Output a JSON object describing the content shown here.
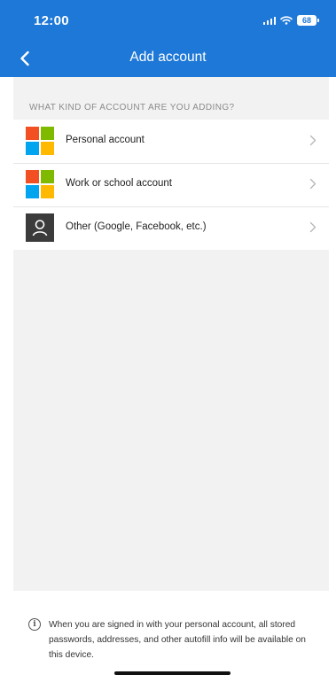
{
  "status_bar": {
    "time": "12:00",
    "battery": "68",
    "icons": [
      "signal-icon",
      "wifi-icon",
      "battery-icon"
    ]
  },
  "nav": {
    "back_icon": "chevron-left-icon",
    "title": "Add account"
  },
  "section_header": "WHAT KIND OF ACCOUNT ARE YOU ADDING?",
  "accounts": [
    {
      "label": "Personal account",
      "icon": "microsoft-logo-icon"
    },
    {
      "label": "Work or school account",
      "icon": "microsoft-logo-icon"
    },
    {
      "label": "Other (Google, Facebook, etc.)",
      "icon": "person-icon"
    }
  ],
  "footer": {
    "icon": "info-icon",
    "text": "When you are signed in with your personal account, all stored passwords, addresses, and other autofill info will be available on this device."
  },
  "colors": {
    "header_bg": "#1e78d7",
    "content_bg": "#f2f2f2",
    "ms_red": "#f25022",
    "ms_green": "#7fba00",
    "ms_blue": "#00a4ef",
    "ms_yellow": "#ffb900"
  }
}
